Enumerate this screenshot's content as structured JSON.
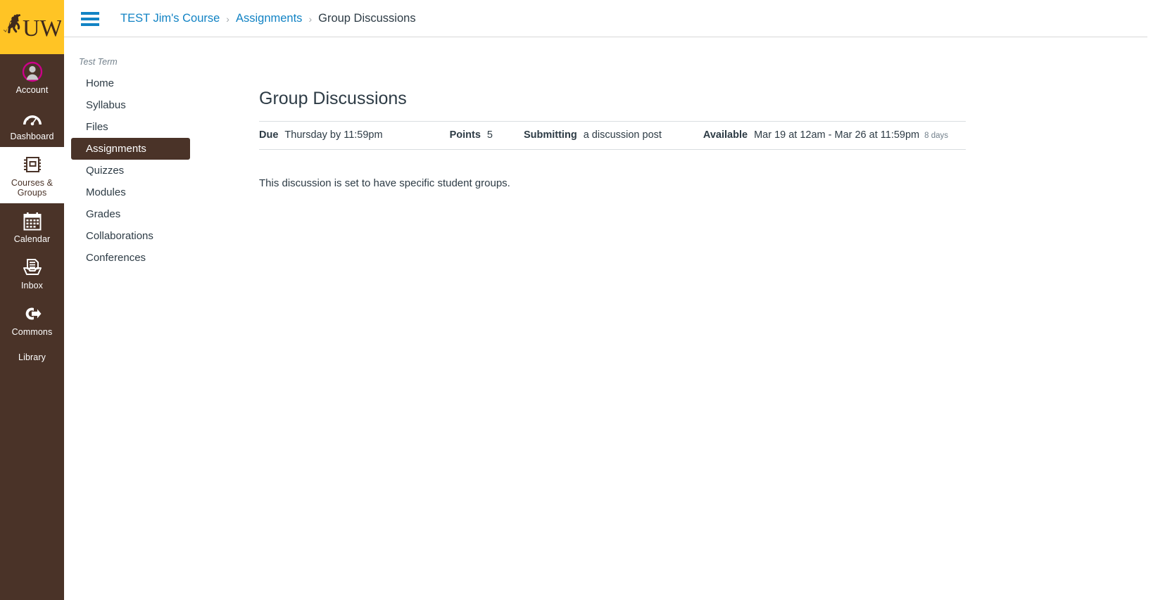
{
  "brand": {
    "logo_name": "uw-bucking-horse-logo",
    "logo_text": "UW",
    "gold": "#ffc425",
    "brown": "#4a3328"
  },
  "global_nav": {
    "items": [
      {
        "label": "Account",
        "icon": "user-avatar-icon",
        "active": false
      },
      {
        "label": "Dashboard",
        "icon": "gauge-icon",
        "active": false
      },
      {
        "label": "Courses & Groups",
        "icon": "notebook-icon",
        "active": true
      },
      {
        "label": "Calendar",
        "icon": "calendar-icon",
        "active": false
      },
      {
        "label": "Inbox",
        "icon": "inbox-tray-icon",
        "active": false
      },
      {
        "label": "Commons",
        "icon": "commons-arrow-icon",
        "active": false
      },
      {
        "label": "Library",
        "icon": "",
        "active": false
      }
    ]
  },
  "topbar": {
    "menu_icon": "hamburger-menu-icon",
    "breadcrumb": {
      "separator": "›",
      "items": [
        {
          "label": "TEST Jim's Course",
          "current": false
        },
        {
          "label": "Assignments",
          "current": false
        },
        {
          "label": "Group Discussions",
          "current": true
        }
      ]
    }
  },
  "course_nav": {
    "term": "Test Term",
    "items": [
      {
        "label": "Home",
        "active": false
      },
      {
        "label": "Syllabus",
        "active": false
      },
      {
        "label": "Files",
        "active": false
      },
      {
        "label": "Assignments",
        "active": true
      },
      {
        "label": "Quizzes",
        "active": false
      },
      {
        "label": "Modules",
        "active": false
      },
      {
        "label": "Grades",
        "active": false
      },
      {
        "label": "Collaborations",
        "active": false
      },
      {
        "label": "Conferences",
        "active": false
      }
    ]
  },
  "main": {
    "title": "Group Discussions",
    "details": {
      "due_label": "Due",
      "due_value": "Thursday by 11:59pm",
      "points_label": "Points",
      "points_value": "5",
      "submitting_label": "Submitting",
      "submitting_value": "a discussion post",
      "available_label": "Available",
      "available_value": "Mar 19 at 12am - Mar 26 at 11:59pm",
      "available_duration": "8 days"
    },
    "message": "This discussion is set to have specific student groups."
  },
  "colors": {
    "link_blue": "#1283c4",
    "text_dark": "#2d3b45",
    "muted": "#73818c",
    "avatar_ring": "#cc0088"
  }
}
